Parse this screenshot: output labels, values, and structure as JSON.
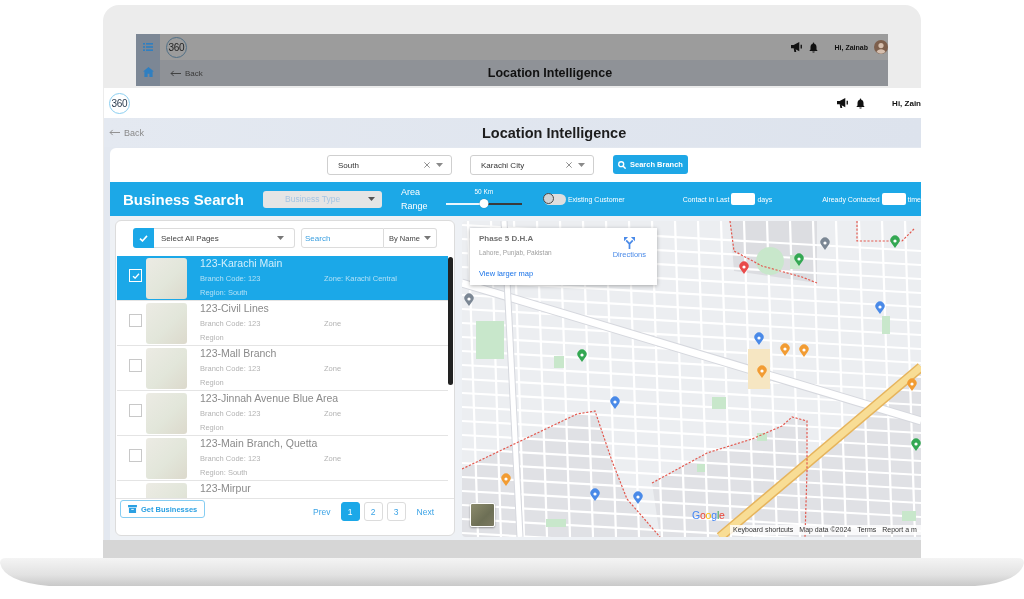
{
  "backdrop_screen": {
    "logo": "360",
    "greeting": "Hi, Zainab",
    "back": "Back",
    "title": "Location Intelligence"
  },
  "header": {
    "logo": "360",
    "greeting": "Hi, Zain"
  },
  "page_bar": {
    "back": "Back",
    "title": "Location Intelligence"
  },
  "filters": {
    "region": "South",
    "city": "Karachi City",
    "search_button": "Search Branch"
  },
  "business_search": {
    "title": "Business Search",
    "business_type": {
      "placeholder": "Business Type",
      "disabled": true
    },
    "area_range": {
      "label": "Area Range",
      "reading": "50 Km",
      "level": 0.5
    },
    "existing_customer": {
      "label": "Existing Customer",
      "on": false
    },
    "contact_last": {
      "label": "Contact in Last",
      "unit": "days"
    },
    "already_contacted": {
      "label": "Already Contacted",
      "unit": "time"
    }
  },
  "branch_list": {
    "select_all": {
      "label": "Select All Pages",
      "checked": true
    },
    "search": {
      "placeholder": "Search"
    },
    "sort": "By Name",
    "rows": [
      {
        "title": "123-Karachi Main",
        "code": "Branch Code: 123",
        "zone": "Zone: Karachi Central",
        "region": "Region: South",
        "selected": true,
        "checked": true
      },
      {
        "title": "123-Civil Lines",
        "code": "Branch Code: 123",
        "zone": "Zone",
        "region": "Region",
        "selected": false,
        "checked": false
      },
      {
        "title": "123-Mall Branch",
        "code": "Branch Code: 123",
        "zone": "Zone",
        "region": "Region",
        "selected": false,
        "checked": false
      },
      {
        "title": "123-Jinnah Avenue Blue Area",
        "code": "Branch Code: 123",
        "zone": "Zone",
        "region": "Region",
        "selected": false,
        "checked": false
      },
      {
        "title": "123-Main Branch, Quetta",
        "code": "Branch Code: 123",
        "zone": "Zone",
        "region": "Region: South",
        "selected": false,
        "checked": false
      },
      {
        "title": "123-Mirpur",
        "selected": false
      }
    ],
    "get_button": "Get Businesses",
    "pagination": {
      "prev": "Prev",
      "pages": [
        {
          "label": "1",
          "selected": true
        },
        {
          "label": "2",
          "selected": false
        },
        {
          "label": "3",
          "selected": false
        }
      ],
      "next": "Next"
    }
  },
  "map": {
    "place": {
      "name": "Phase 5 D.H.A",
      "address": "Lahore, Punjab, Pakistan",
      "directions": "Directions",
      "larger_map": "View larger map"
    },
    "logo": "Google",
    "attribution": [
      "Keyboard shortcuts",
      "Map data ©2024",
      "Terms",
      "Report a m"
    ]
  }
}
